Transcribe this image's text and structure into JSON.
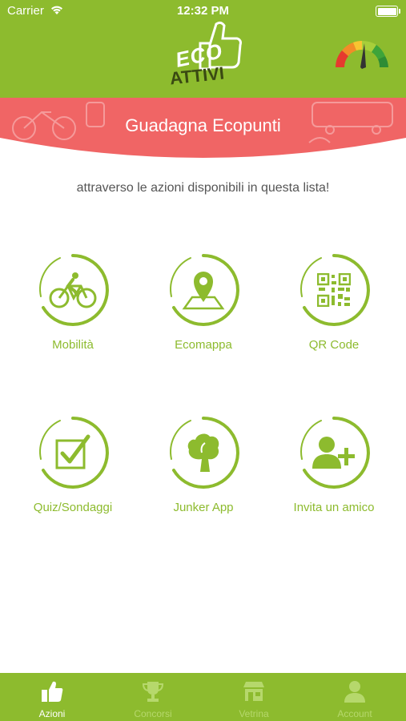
{
  "status_bar": {
    "carrier": "Carrier",
    "time": "12:32 PM"
  },
  "logo": {
    "line1": "ECO",
    "line2": "ATTIVI"
  },
  "banner": {
    "title": "Guadagna Ecopunti"
  },
  "subtitle": "attraverso le azioni disponibili in questa lista!",
  "actions": [
    {
      "label": "Mobilità",
      "icon": "bicycle-icon"
    },
    {
      "label": "Ecomappa",
      "icon": "map-pin-icon"
    },
    {
      "label": "QR Code",
      "icon": "qr-code-icon"
    },
    {
      "label": "Quiz/Sondaggi",
      "icon": "checkbox-icon"
    },
    {
      "label": "Junker App",
      "icon": "tree-icon"
    },
    {
      "label": "Invita un amico",
      "icon": "add-user-icon"
    }
  ],
  "tabs": [
    {
      "label": "Azioni",
      "icon": "thumbs-up-icon",
      "active": true
    },
    {
      "label": "Concorsi",
      "icon": "trophy-icon",
      "active": false
    },
    {
      "label": "Vetrina",
      "icon": "shop-icon",
      "active": false
    },
    {
      "label": "Account",
      "icon": "user-icon",
      "active": false
    }
  ],
  "colors": {
    "brand_green": "#8dbb2e",
    "banner_red": "#f06565",
    "label_green": "#8dbb2e"
  }
}
